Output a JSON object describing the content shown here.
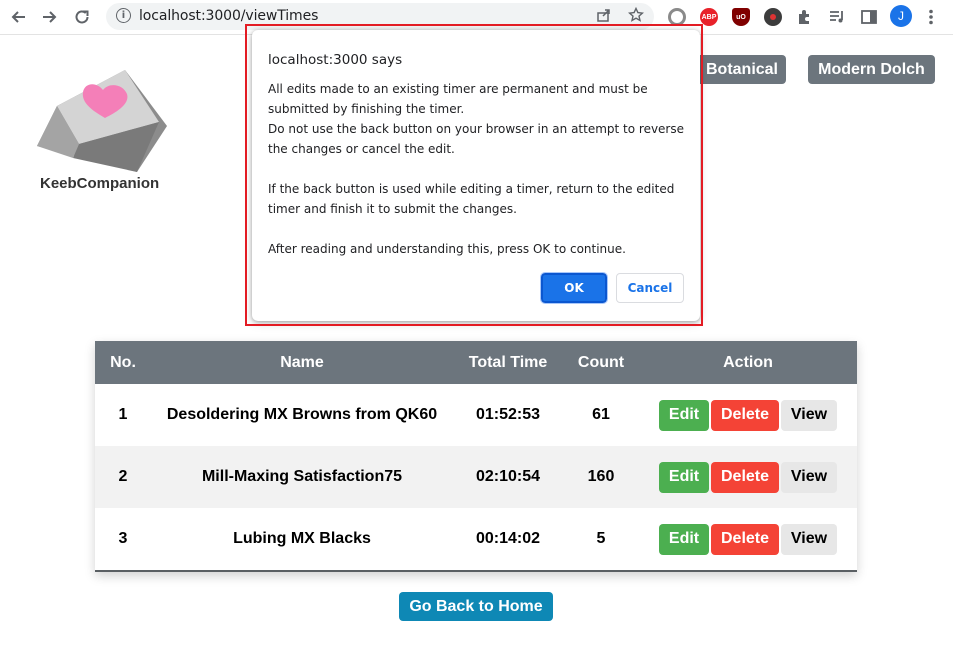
{
  "browser": {
    "url": "localhost:3000/viewTimes",
    "profile_initial": "J",
    "extensions": [
      "ABP",
      "uO"
    ]
  },
  "logo": {
    "name": "KeebCompanion"
  },
  "themes": [
    "Botanical",
    "Modern Dolch"
  ],
  "dialog": {
    "title": "localhost:3000 says",
    "message": "All edits made to an existing timer are permanent and must be submitted by finishing the timer.\nDo not use the back button on your browser in an attempt to reverse the changes or cancel the edit.\n\nIf the back button is used while editing a timer, return to the edited timer and finish it to submit the changes.\n\nAfter reading and understanding this, press OK to continue.",
    "ok_label": "OK",
    "cancel_label": "Cancel"
  },
  "table": {
    "headers": [
      "No.",
      "Name",
      "Total Time",
      "Count",
      "Action"
    ],
    "rows": [
      {
        "no": "1",
        "name": "Desoldering MX Browns from QK60",
        "total_time": "01:52:53",
        "count": "61"
      },
      {
        "no": "2",
        "name": "Mill-Maxing Satisfaction75",
        "total_time": "02:10:54",
        "count": "160"
      },
      {
        "no": "3",
        "name": "Lubing MX Blacks",
        "total_time": "00:14:02",
        "count": "5"
      }
    ],
    "actions": {
      "edit": "Edit",
      "delete": "Delete",
      "view": "View"
    }
  },
  "home_button": "Go Back to Home",
  "colors": {
    "header_gray": "#6c757d",
    "edit_green": "#4caf50",
    "delete_red": "#f44336",
    "view_gray": "#e7e7e7",
    "home_blue": "#0e88b5",
    "highlight_red": "#e31b23",
    "ok_blue": "#1a73e8"
  }
}
